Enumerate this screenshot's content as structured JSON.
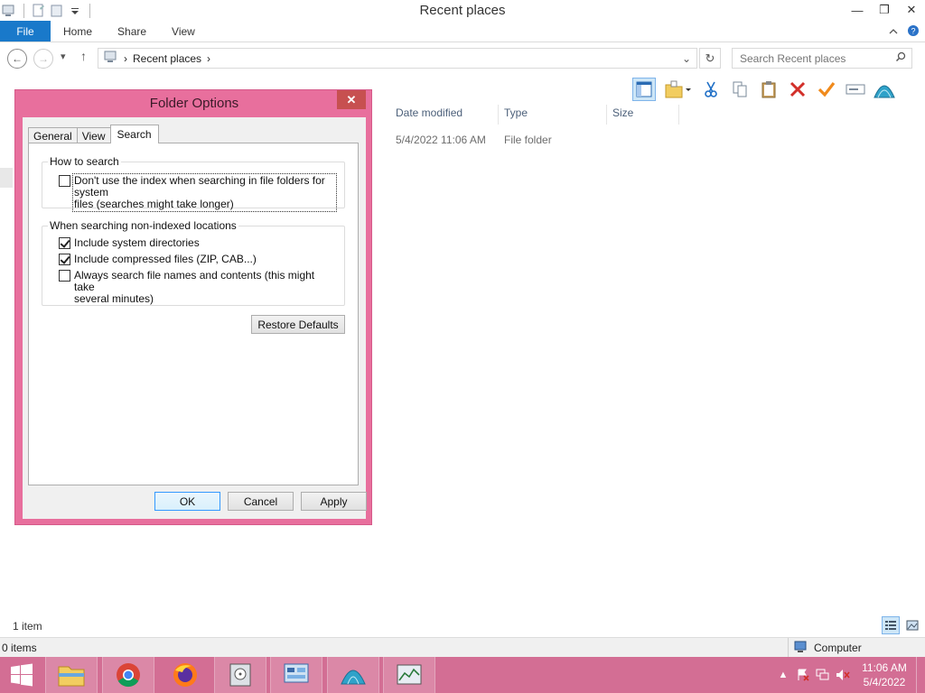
{
  "window": {
    "title": "Recent places",
    "minimize": "—",
    "restore": "❐",
    "close": "✕"
  },
  "ribbon": {
    "tabs": [
      "File",
      "Home",
      "Share",
      "View"
    ],
    "collapse_icon": "chevron-up-icon",
    "help_icon": "help-icon"
  },
  "address": {
    "back": "←",
    "forward": "→",
    "recent": "▾",
    "up": "↑",
    "path_sep1": "›",
    "location": "Recent places",
    "path_sep2": "›",
    "dropdown": "⌄",
    "refresh": "↻",
    "search_placeholder": "Search Recent places",
    "search_icon": "⚲"
  },
  "columns": {
    "date_modified": "Date modified",
    "type": "Type",
    "size": "Size"
  },
  "rows": [
    {
      "date": "5/4/2022 11:06 AM",
      "type": "File folder"
    }
  ],
  "status": {
    "count": "1 item",
    "selected": "0 items",
    "computer": "Computer"
  },
  "dialog": {
    "title": "Folder Options",
    "close": "✕",
    "tabs": [
      "General",
      "View",
      "Search"
    ],
    "how_to_search": {
      "legend": "How to search",
      "dont_use_index_line1": "Don't use the index when searching in file folders for system",
      "dont_use_index_line2": "files (searches might take longer)",
      "dont_use_index_checked": false
    },
    "non_indexed": {
      "legend": "When searching non-indexed locations",
      "include_system_dirs": "Include system directories",
      "include_system_dirs_checked": true,
      "include_compressed": "Include compressed files (ZIP, CAB...)",
      "include_compressed_checked": true,
      "always_search_line1": "Always search file names and contents (this might take",
      "always_search_line2": "several minutes)",
      "always_search_checked": false
    },
    "restore_defaults": "Restore Defaults",
    "ok": "OK",
    "cancel": "Cancel",
    "apply": "Apply"
  },
  "taskbar": {
    "time": "11:06 AM",
    "date": "5/4/2022",
    "items": [
      "start-icon",
      "file-explorer-icon",
      "chrome-icon",
      "firefox-icon",
      "disk-utility-icon",
      "control-panel-icon",
      "network-globe-icon",
      "task-manager-icon"
    ]
  },
  "colors": {
    "accent": "#1979ca",
    "dialog_frame": "#e86f9d",
    "taskbar": "#d36e94",
    "close_red": "#c75050"
  }
}
